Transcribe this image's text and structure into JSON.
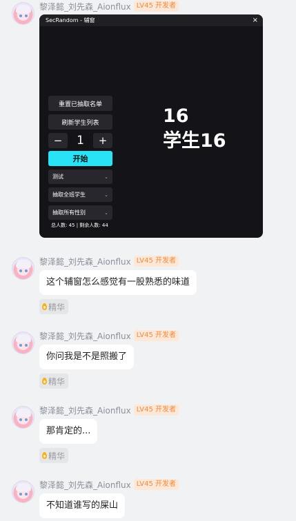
{
  "messages": [
    {
      "username": "黎泽懿_刘先森_Aionflux",
      "badge": "LV45 开发者",
      "app": {
        "title": "SecRandom - 辅窗",
        "close": "×",
        "reset_label": "重置已抽取名单",
        "refresh_label": "刷新学生列表",
        "minus": "−",
        "count": "1",
        "plus": "+",
        "start_label": "开始",
        "select_class": "测试",
        "select_mode": "抽取全班学生",
        "select_gender": "抽取所有性别",
        "stats": "总人数: 45 | 剩余人数: 44",
        "result_number": "16",
        "result_name": "学生16"
      }
    },
    {
      "username": "黎泽懿_刘先森_Aionflux",
      "badge": "LV45 开发者",
      "text": "这个辅窗怎么感觉有一股熟悉的味道",
      "essence": "精华"
    },
    {
      "username": "黎泽懿_刘先森_Aionflux",
      "badge": "LV45 开发者",
      "text": "你问我是不是照搬了",
      "essence": "精华"
    },
    {
      "username": "黎泽懿_刘先森_Aionflux",
      "badge": "LV45 开发者",
      "text": "那肯定的...",
      "essence": "精华"
    },
    {
      "username": "黎泽懿_刘先森_Aionflux",
      "badge": "LV45 开发者",
      "text": "不知道谁写的屎山"
    }
  ]
}
